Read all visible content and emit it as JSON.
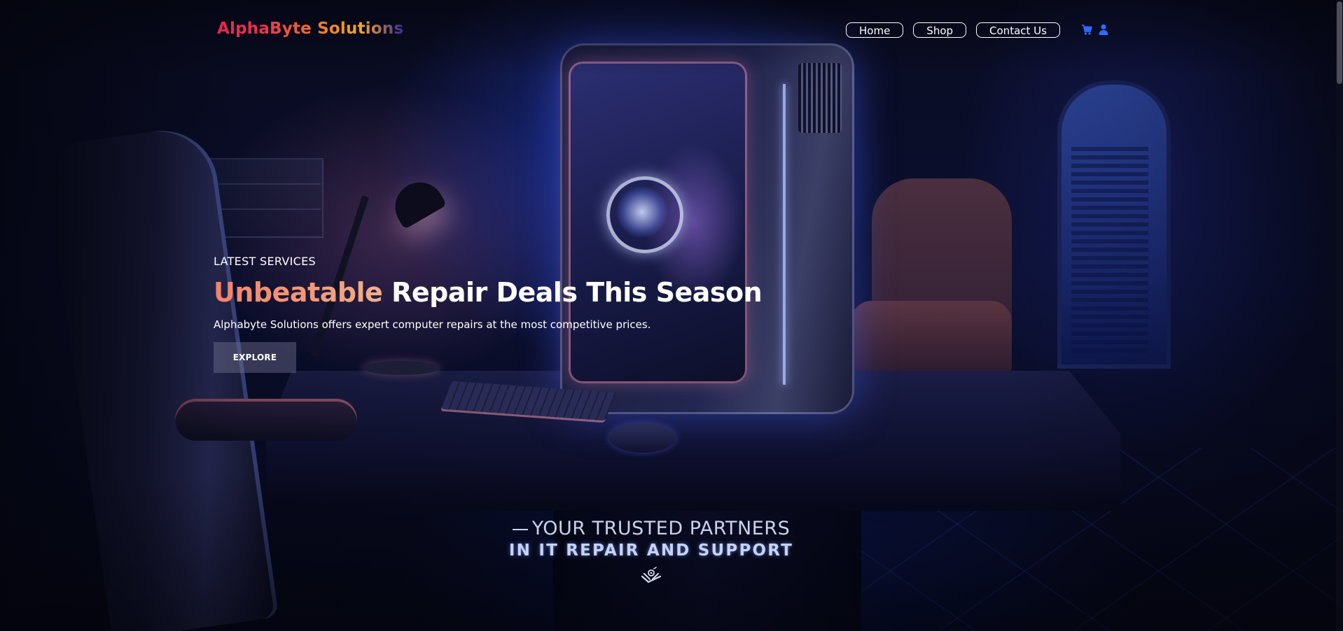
{
  "brand": {
    "logo_text": "AlphaByte Solutions"
  },
  "nav": {
    "items": [
      {
        "label": "Home"
      },
      {
        "label": "Shop"
      },
      {
        "label": "Contact Us"
      }
    ],
    "icons": [
      {
        "name": "cart-icon",
        "color": "#2f6bff"
      },
      {
        "name": "user-icon",
        "color": "#2f6bff"
      }
    ]
  },
  "hero": {
    "eyebrow": "LATEST SERVICES",
    "headline_accent": "Unbeatable",
    "headline_rest": "Repair Deals This Season",
    "subline": "Alphabyte Solutions offers expert computer repairs at the most competitive prices.",
    "cta_label": "EXPLORE"
  },
  "tagline": {
    "line1": "YOUR TRUSTED PARTNERS",
    "line2": "IN IT REPAIR AND SUPPORT",
    "emblem_icon": "wrench-emblem-icon"
  },
  "colors": {
    "logo_gradient": [
      "#e8244f",
      "#f07a2a",
      "#f5a623",
      "#3b2a9e"
    ],
    "headline_accent": "#f3836b",
    "nav_border": "#ffffff",
    "icon_blue": "#2f6bff"
  }
}
